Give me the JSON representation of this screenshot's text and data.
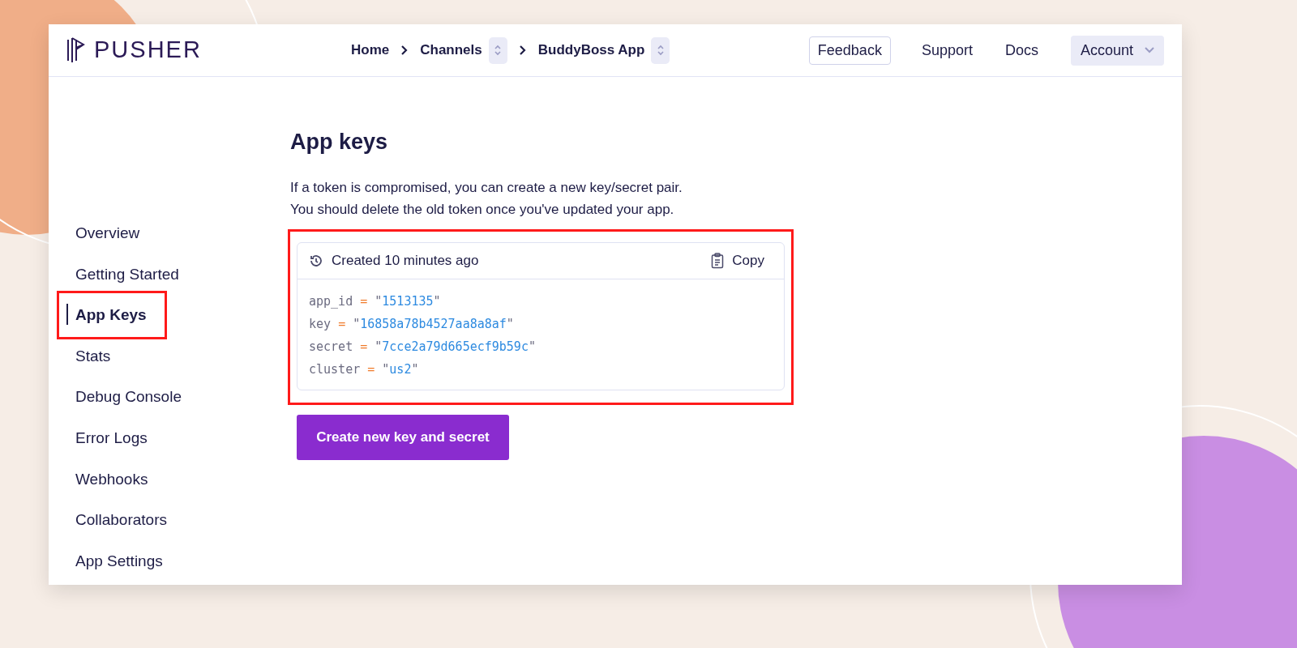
{
  "logo": {
    "text": "PUSHER"
  },
  "breadcrumb": [
    {
      "label": "Home",
      "switcher": false
    },
    {
      "label": "Channels",
      "switcher": true
    },
    {
      "label": "BuddyBoss App",
      "switcher": true
    }
  ],
  "nav": [
    {
      "label": "Feedback",
      "kind": "outlined"
    },
    {
      "label": "Support",
      "kind": "plain"
    },
    {
      "label": "Docs",
      "kind": "plain"
    },
    {
      "label": "Account",
      "kind": "menu"
    }
  ],
  "sidebar": {
    "items": [
      {
        "label": "Overview",
        "selected": false,
        "highlighted": false
      },
      {
        "label": "Getting Started",
        "selected": false,
        "highlighted": false
      },
      {
        "label": "App Keys",
        "selected": true,
        "highlighted": true
      },
      {
        "label": "Stats",
        "selected": false,
        "highlighted": false
      },
      {
        "label": "Debug Console",
        "selected": false,
        "highlighted": false
      },
      {
        "label": "Error Logs",
        "selected": false,
        "highlighted": false
      },
      {
        "label": "Webhooks",
        "selected": false,
        "highlighted": false
      },
      {
        "label": "Collaborators",
        "selected": false,
        "highlighted": false
      },
      {
        "label": "App Settings",
        "selected": false,
        "highlighted": false
      }
    ]
  },
  "main": {
    "title": "App keys",
    "description": [
      "If a token is compromised, you can create a new key/secret pair.",
      "You should delete the old token once you've updated your app."
    ],
    "keys_card": {
      "highlighted": true,
      "created": "Created 10 minutes ago",
      "copy": "Copy",
      "lines": [
        {
          "key": "app_id",
          "op": "=",
          "quote": "\"",
          "value": "1513135"
        },
        {
          "key": "key",
          "op": "=",
          "quote": "\"",
          "value": "16858a78b4527aa8a8af"
        },
        {
          "key": "secret",
          "op": "=",
          "quote": "\"",
          "value": "7cce2a79d665ecf9b59c"
        },
        {
          "key": "cluster",
          "op": "=",
          "quote": "\"",
          "value": "us2"
        }
      ]
    },
    "button": "Create new key and secret"
  }
}
